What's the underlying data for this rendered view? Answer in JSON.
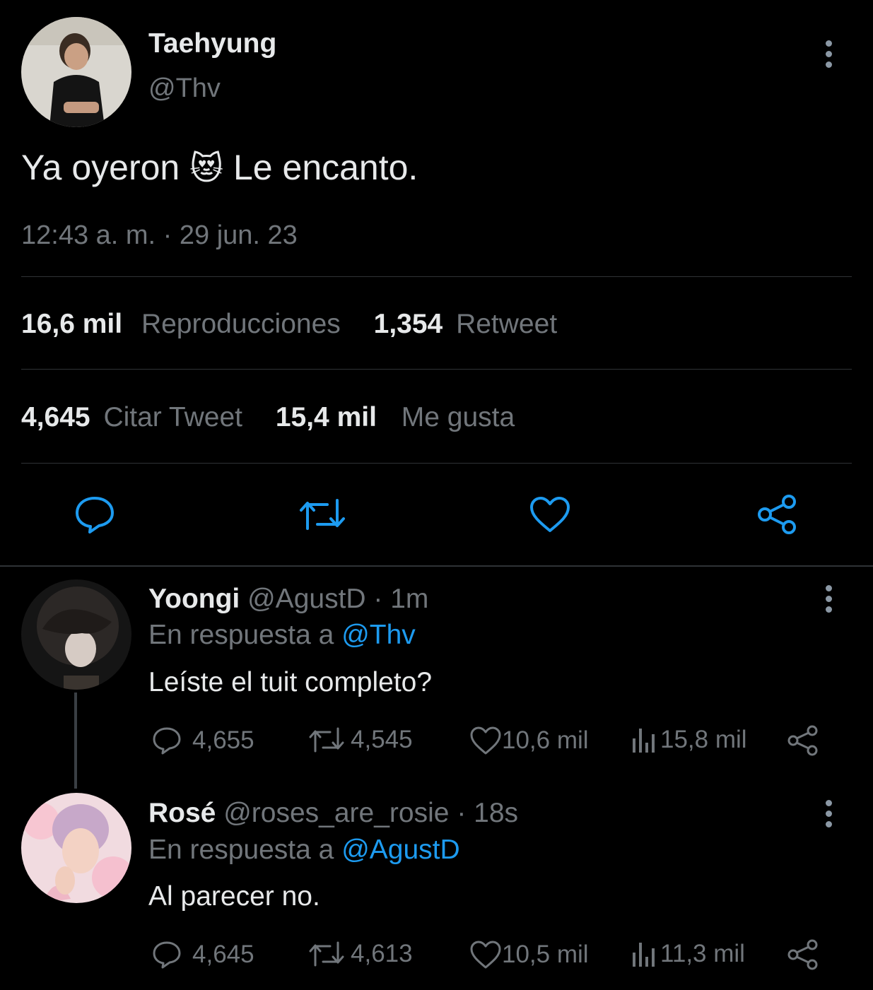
{
  "tweet": {
    "author_name": "Taehyung",
    "author_handle": "@Thv",
    "text_before": "Ya oyeron",
    "emoji": "😻",
    "text_after": "Le encanto.",
    "timestamp": "12:43 a. m. · 29 jun. 23",
    "stats": {
      "views_count": "16,6 mil",
      "views_label": "Reproducciones",
      "retweets_count": "1,354",
      "retweets_label": "Retweet",
      "quotes_count": "4,645",
      "quotes_label": "Citar Tweet",
      "likes_count": "15,4 mil",
      "likes_label": "Me gusta"
    }
  },
  "replies": [
    {
      "author_name": "Yoongi",
      "author_handle": "@AgustD",
      "time": "· 1m",
      "in_reply_prefix": "En respuesta a",
      "in_reply_handle": "@Thv",
      "text": "Leíste el tuit completo?",
      "reply_count": "4,655",
      "retweet_count": "4,545",
      "like_count": "10,6 mil",
      "view_count": "15,8 mil"
    },
    {
      "author_name": "Rosé",
      "author_handle": "@roses_are_rosie",
      "time": "· 18s",
      "in_reply_prefix": "En respuesta a",
      "in_reply_handle": "@AgustD",
      "text": "Al parecer no.",
      "reply_count": "4,645",
      "retweet_count": "4,613",
      "like_count": "10,5 mil",
      "view_count": "11,3 mil"
    }
  ],
  "colors": {
    "background": "#000000",
    "text": "#e7e9ea",
    "muted": "#71767b",
    "link": "#1d9bf0",
    "divider": "#2f3336"
  }
}
